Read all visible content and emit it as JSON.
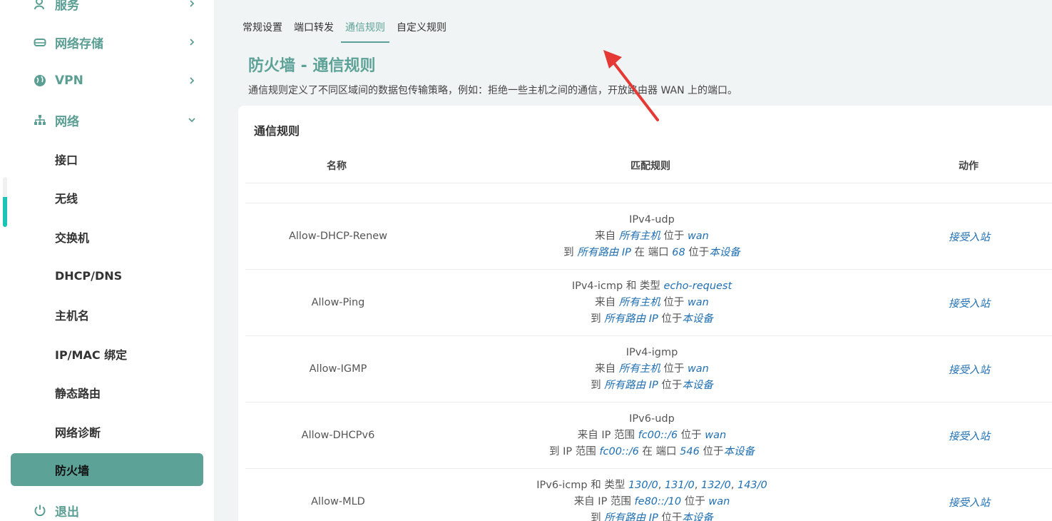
{
  "sidebar": {
    "top_items": [
      {
        "label": "服务",
        "icon": "user-icon"
      },
      {
        "label": "网络存储",
        "icon": "drive-icon"
      },
      {
        "label": "VPN",
        "icon": "globe-icon"
      },
      {
        "label": "网络",
        "icon": "network-icon"
      }
    ],
    "sub_items": [
      "接口",
      "无线",
      "交换机",
      "DHCP/DNS",
      "主机名",
      "IP/MAC 绑定",
      "静态路由",
      "网络诊断",
      "防火墙"
    ],
    "logout": {
      "label": "退出",
      "icon": "power-icon"
    }
  },
  "tabs": [
    "常规设置",
    "端口转发",
    "通信规则",
    "自定义规则"
  ],
  "active_tab": "通信规则",
  "page": {
    "title": "防火墙 - 通信规则",
    "description": "通信规则定义了不同区域间的数据包传输策略，例如：拒绝一些主机之间的通信，开放路由器 WAN 上的端口。"
  },
  "card": {
    "title": "通信规则",
    "columns": {
      "name": "名称",
      "match": "匹配规则",
      "action": "动作"
    }
  },
  "rules": [
    {
      "name": "Allow-DHCP-Renew",
      "line1": [
        [
          "t",
          "IPv4-udp"
        ]
      ],
      "line2": [
        [
          "t",
          "来自 "
        ],
        [
          "v",
          "所有主机"
        ],
        [
          "t",
          " 位于 "
        ],
        [
          "v",
          "wan"
        ]
      ],
      "line3": [
        [
          "t",
          "到 "
        ],
        [
          "v",
          "所有路由 IP"
        ],
        [
          "t",
          " 在 端口 "
        ],
        [
          "v",
          "68"
        ],
        [
          "t",
          " 位于"
        ],
        [
          "v",
          "本设备"
        ]
      ],
      "action": "接受入站"
    },
    {
      "name": "Allow-Ping",
      "line1": [
        [
          "t",
          "IPv4-icmp 和 类型 "
        ],
        [
          "v",
          "echo-request"
        ]
      ],
      "line2": [
        [
          "t",
          "来自 "
        ],
        [
          "v",
          "所有主机"
        ],
        [
          "t",
          " 位于 "
        ],
        [
          "v",
          "wan"
        ]
      ],
      "line3": [
        [
          "t",
          "到 "
        ],
        [
          "v",
          "所有路由 IP"
        ],
        [
          "t",
          " 位于"
        ],
        [
          "v",
          "本设备"
        ]
      ],
      "action": "接受入站"
    },
    {
      "name": "Allow-IGMP",
      "line1": [
        [
          "t",
          "IPv4-igmp"
        ]
      ],
      "line2": [
        [
          "t",
          "来自 "
        ],
        [
          "v",
          "所有主机"
        ],
        [
          "t",
          " 位于 "
        ],
        [
          "v",
          "wan"
        ]
      ],
      "line3": [
        [
          "t",
          "到 "
        ],
        [
          "v",
          "所有路由 IP"
        ],
        [
          "t",
          " 位于"
        ],
        [
          "v",
          "本设备"
        ]
      ],
      "action": "接受入站"
    },
    {
      "name": "Allow-DHCPv6",
      "line1": [
        [
          "t",
          "IPv6-udp"
        ]
      ],
      "line2": [
        [
          "t",
          "来自 IP 范围 "
        ],
        [
          "v",
          "fc00::/6"
        ],
        [
          "t",
          " 位于 "
        ],
        [
          "v",
          "wan"
        ]
      ],
      "line3": [
        [
          "t",
          "到 IP 范围 "
        ],
        [
          "v",
          "fc00::/6"
        ],
        [
          "t",
          " 在 端口 "
        ],
        [
          "v",
          "546"
        ],
        [
          "t",
          " 位于"
        ],
        [
          "v",
          "本设备"
        ]
      ],
      "action": "接受入站"
    },
    {
      "name": "Allow-MLD",
      "line1": [
        [
          "t",
          "IPv6-icmp 和 类型 "
        ],
        [
          "v",
          "130/0"
        ],
        [
          "t",
          ", "
        ],
        [
          "v",
          "131/0"
        ],
        [
          "t",
          ", "
        ],
        [
          "v",
          "132/0"
        ],
        [
          "t",
          ", "
        ],
        [
          "v",
          "143/0"
        ]
      ],
      "line2": [
        [
          "t",
          "来自 IP 范围 "
        ],
        [
          "v",
          "fe80::/10"
        ],
        [
          "t",
          " 位于 "
        ],
        [
          "v",
          "wan"
        ]
      ],
      "line3": [
        [
          "t",
          "到 "
        ],
        [
          "v",
          "所有路由 IP"
        ],
        [
          "t",
          " 位于"
        ],
        [
          "v",
          "本设备"
        ]
      ],
      "action": "接受入站"
    }
  ],
  "colors": {
    "accent": "#5ca297",
    "link": "#1f6fb2",
    "annotation": "#e53935"
  }
}
